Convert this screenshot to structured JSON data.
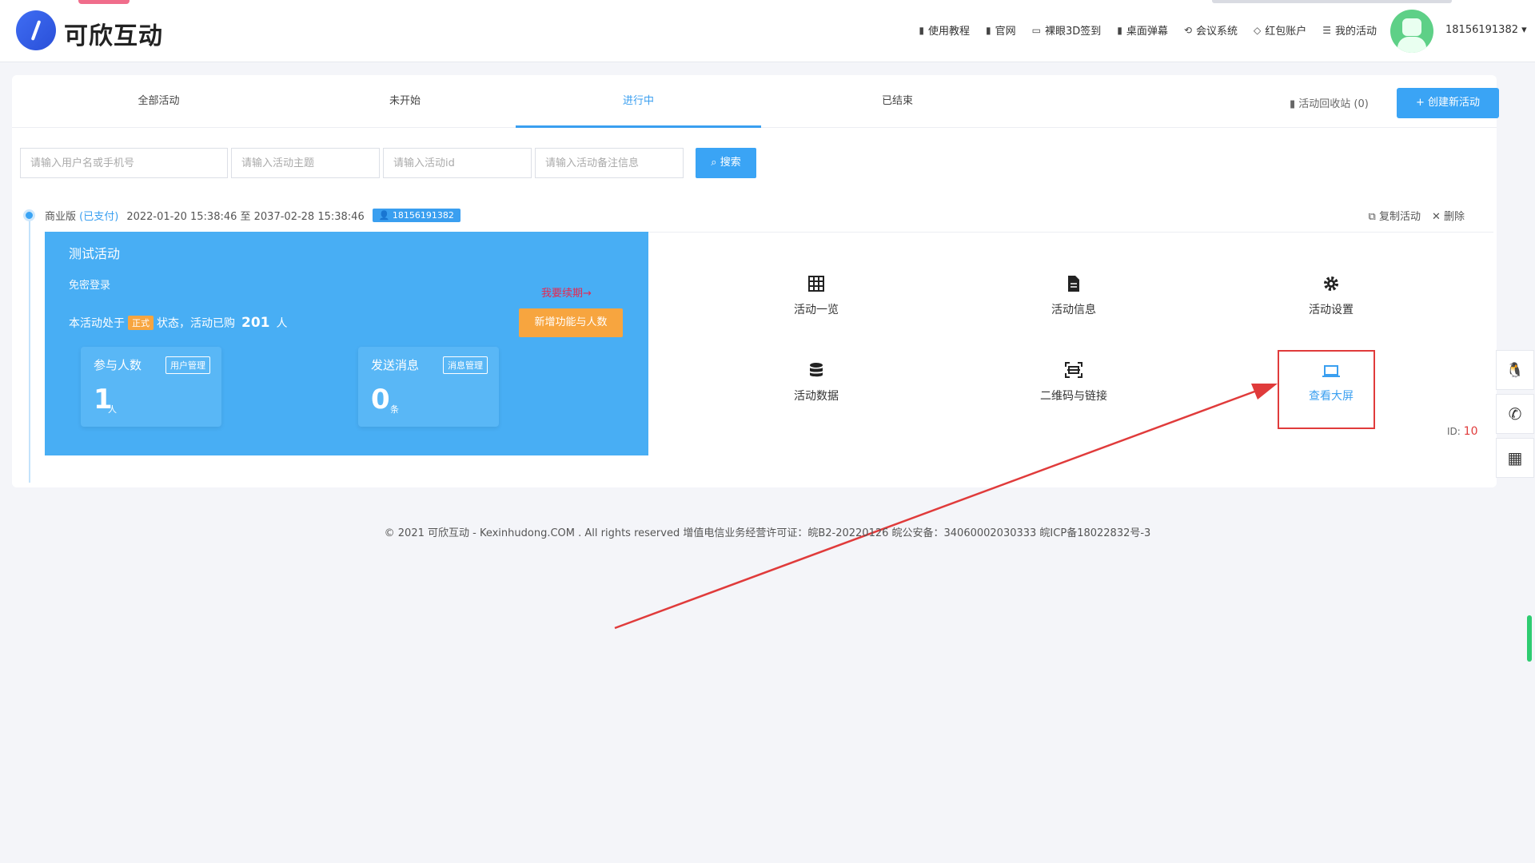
{
  "brand": {
    "name": "可欣互动"
  },
  "nav": [
    {
      "label": "使用教程",
      "icon": "doc-icon"
    },
    {
      "label": "官网",
      "icon": "doc-icon"
    },
    {
      "label": "裸眼3D签到",
      "icon": "monitor-icon"
    },
    {
      "label": "桌面弹幕",
      "icon": "doc-icon"
    },
    {
      "label": "会议系统",
      "icon": "link-icon"
    },
    {
      "label": "红包账户",
      "icon": "diamond-icon"
    },
    {
      "label": "我的活动",
      "icon": "list-icon"
    }
  ],
  "user": {
    "phone": "18156191382 ▾"
  },
  "tabs": [
    {
      "label": "全部活动"
    },
    {
      "label": "未开始"
    },
    {
      "label": "进行中",
      "active": true
    },
    {
      "label": "已结束"
    }
  ],
  "recycle": "活动回收站 (0)",
  "create_button": "+ 创建新活动",
  "search": {
    "username_placeholder": "请输入用户名或手机号",
    "theme_placeholder": "请输入活动主题",
    "id_placeholder": "请输入活动id",
    "note_placeholder": "请输入活动备注信息",
    "button": "搜索"
  },
  "activity": {
    "edition": "商业版",
    "paid": "(已支付)",
    "period": "2022-01-20 15:38:46 至 2037-02-28 15:38:46",
    "owner_phone": "18156191382",
    "copy": "复制活动",
    "delete": "删除",
    "title": "测试活动",
    "login": "免密登录",
    "renew": "我要续期→",
    "add_feature": "新增功能与人数",
    "status_prefix": "本活动处于",
    "status_tag": "正式",
    "status_mid": "状态，活动已购",
    "purchased": "201",
    "purchased_unit": "人",
    "participants": {
      "label": "参与人数",
      "tag": "用户管理",
      "value": "1",
      "unit": "人"
    },
    "messages": {
      "label": "发送消息",
      "tag": "消息管理",
      "value": "0",
      "unit": "条"
    },
    "id_prefix": "ID:",
    "id": "10"
  },
  "functions": [
    {
      "label": "活动一览",
      "icon": "grid-icon"
    },
    {
      "label": "活动信息",
      "icon": "file-icon"
    },
    {
      "label": "活动设置",
      "icon": "gear-icon"
    },
    {
      "label": "活动数据",
      "icon": "database-icon"
    },
    {
      "label": "二维码与链接",
      "icon": "qrcode-scan-icon"
    },
    {
      "label": "查看大屏",
      "icon": "laptop-icon",
      "highlighted": true
    }
  ],
  "footer": "© 2021 可欣互动 - Kexinhudong.COM . All rights reserved 增值电信业务经营许可证：皖B2-20220126 皖公安备：34060002030333 皖ICP备18022832号-3",
  "colors": {
    "accent": "#3aa4f5",
    "panel": "#48aef4",
    "orange": "#f7a53f",
    "annotation_red": "#e03b3b"
  }
}
